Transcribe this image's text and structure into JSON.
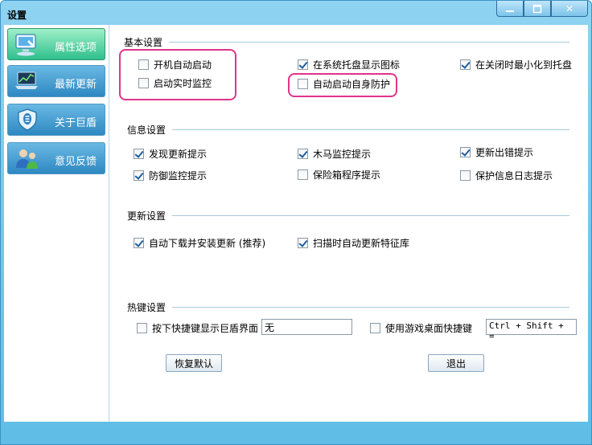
{
  "window": {
    "title": "设置",
    "minimize_icon": "minimize-icon",
    "maximize_icon": "maximize-icon",
    "close_icon": "close-icon",
    "close_glyph": "✕"
  },
  "sidebar": {
    "items": [
      {
        "label": "属性选项",
        "icon": "monitor-hand-icon",
        "active": true
      },
      {
        "label": "最新更新",
        "icon": "laptop-chart-icon",
        "active": false
      },
      {
        "label": "关于巨盾",
        "icon": "shield-icon",
        "active": false
      },
      {
        "label": "意见反馈",
        "icon": "users-icon",
        "active": false
      }
    ]
  },
  "sections": {
    "basic": {
      "title": "基本设置",
      "options": [
        {
          "label": "开机自动启动",
          "checked": false
        },
        {
          "label": "启动实时监控",
          "checked": false
        },
        {
          "label": "在系统托盘显示图标",
          "checked": true
        },
        {
          "label": "自动启动自身防护",
          "checked": false
        },
        {
          "label": "在关闭时最小化到托盘",
          "checked": true
        }
      ]
    },
    "info": {
      "title": "信息设置",
      "options": [
        {
          "label": "发现更新提示",
          "checked": true
        },
        {
          "label": "防御监控提示",
          "checked": true
        },
        {
          "label": "木马监控提示",
          "checked": true
        },
        {
          "label": "保险箱程序提示",
          "checked": false
        },
        {
          "label": "更新出错提示",
          "checked": true
        },
        {
          "label": "保护信息日志提示",
          "checked": false
        }
      ]
    },
    "update": {
      "title": "更新设置",
      "options": [
        {
          "label": "自动下载并安装更新 (推荐)",
          "checked": true
        },
        {
          "label": "扫描时自动更新特征库",
          "checked": true
        }
      ]
    },
    "hotkey": {
      "title": "热键设置",
      "options": [
        {
          "label": "按下快捷键显示巨盾界面",
          "checked": false,
          "value": "无"
        },
        {
          "label": "使用游戏桌面快捷键",
          "checked": false,
          "value": "Ctrl + Shift + ="
        }
      ]
    }
  },
  "buttons": {
    "restore_default": "恢复默认",
    "exit": "退出"
  },
  "colors": {
    "accent": "#5fbde6",
    "nav_active": "#2fbf8d",
    "nav_inactive": "#2e88c2",
    "highlight": "#e0348a"
  }
}
